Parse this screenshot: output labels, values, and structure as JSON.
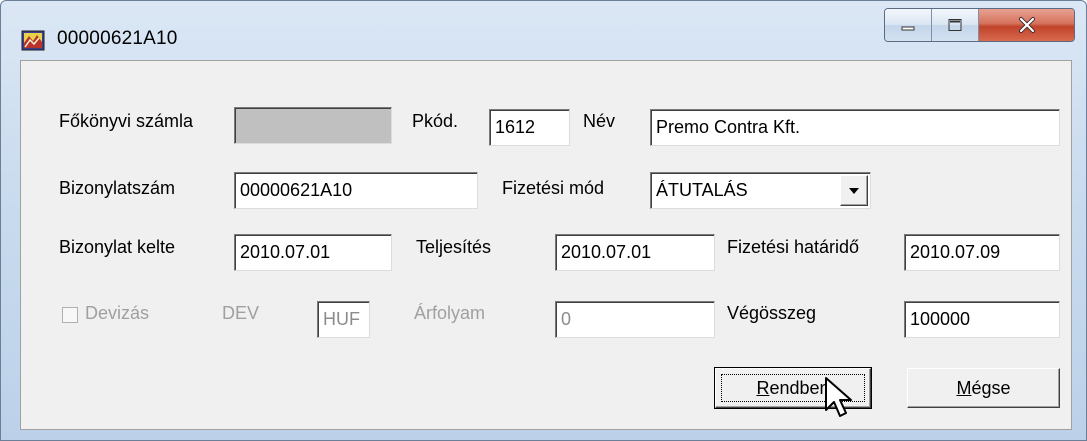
{
  "window": {
    "title": "00000621A10",
    "controls": {
      "minimize": "minimize",
      "maximize": "maximize",
      "close": "close"
    }
  },
  "form": {
    "fokonyvi_label": "Főkönyvi számla",
    "fokonyvi_value": "",
    "pkod_label": "Pkód.",
    "pkod_value": "1612",
    "nev_label": "Név",
    "nev_value": "Premo Contra Kft.",
    "bizonylatszam_label": "Bizonylatszám",
    "bizonylatszam_value": "00000621A10",
    "fizetesi_mod_label": "Fizetési mód",
    "fizetesi_mod_value": "ÁTUTALÁS",
    "bizonylat_kelte_label": "Bizonylat kelte",
    "bizonylat_kelte_value": "2010.07.01",
    "teljesites_label": "Teljesítés",
    "teljesites_value": "2010.07.01",
    "fizetesi_hatarido_label": "Fizetési határidő",
    "fizetesi_hatarido_value": "2010.07.09",
    "devizas_label": "Devizás",
    "devizas_checked": false,
    "dev_label": "DEV",
    "dev_value": "HUF",
    "arfolyam_label": "Árfolyam",
    "arfolyam_value": "0",
    "vegosszeg_label": "Végösszeg",
    "vegosszeg_value": "100000"
  },
  "buttons": {
    "ok_mnemonic": "R",
    "ok_rest": "endben",
    "cancel_mnemonic": "M",
    "cancel_rest": "égse"
  }
}
